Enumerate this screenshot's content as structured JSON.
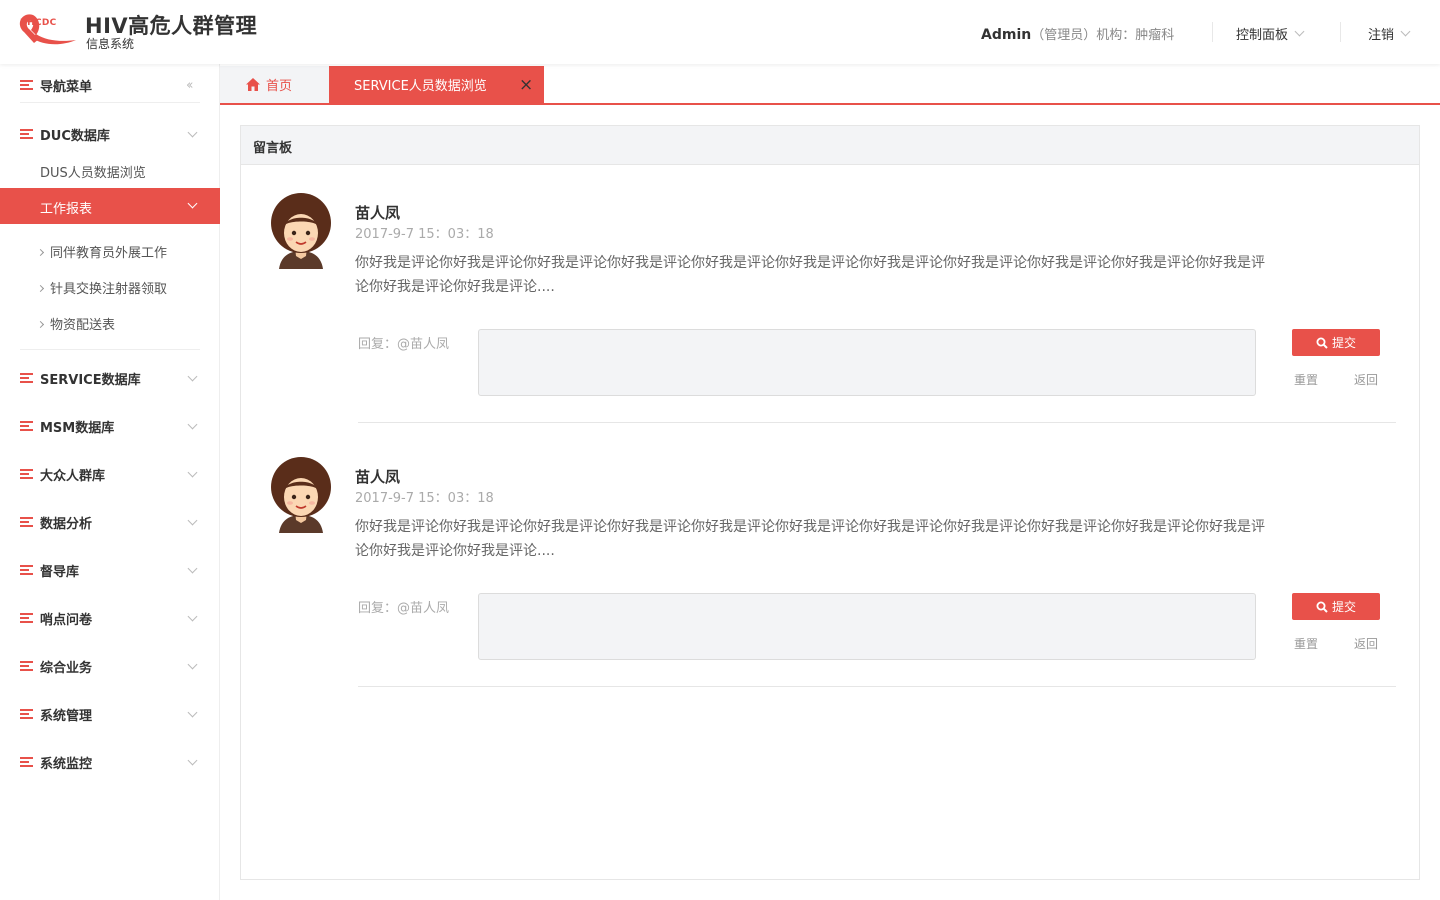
{
  "app": {
    "logo_text": "BHCDC",
    "title": "HIV高危人群管理",
    "subtitle": "信息系统"
  },
  "header": {
    "user_name": "Admin",
    "user_role": "（管理员）",
    "org_label": "机构：",
    "org_name": "肿瘤科",
    "control_panel_label": "控制面板",
    "logout_label": "注销"
  },
  "sidebar": {
    "nav_title": "导航菜单",
    "sections": [
      {
        "label": "DUC数据库"
      },
      {
        "label": "SERVICE数据库"
      },
      {
        "label": "MSM数据库"
      },
      {
        "label": "大众人群库"
      },
      {
        "label": "数据分析"
      },
      {
        "label": "督导库"
      },
      {
        "label": "哨点问卷"
      },
      {
        "label": "综合业务"
      },
      {
        "label": "系统管理"
      },
      {
        "label": "系统监控"
      }
    ],
    "duc_children": {
      "browse": "DUS人员数据浏览",
      "report": "工作报表",
      "report_children": [
        "同伴教育员外展工作",
        "针具交换注射器领取",
        "物资配送表"
      ]
    }
  },
  "tabs": {
    "home": "首页",
    "active": "SERVICE人员数据浏览",
    "close_symbol": "×"
  },
  "panel": {
    "title": "留言板",
    "comments": [
      {
        "author": "苗人凤",
        "time": "2017-9-7 15：03：18",
        "text": "你好我是评论你好我是评论你好我是评论你好我是评论你好我是评论你好我是评论你好我是评论你好我是评论你好我是评论你好我是评论你好我是评论你好我是评论你好我是评论....",
        "reply_label": "回复：@苗人凤",
        "submit_label": "提交",
        "reset_label": "重置",
        "back_label": "返回"
      },
      {
        "author": "苗人凤",
        "time": "2017-9-7 15：03：18",
        "text": "你好我是评论你好我是评论你好我是评论你好我是评论你好我是评论你好我是评论你好我是评论你好我是评论你好我是评论你好我是评论你好我是评论你好我是评论你好我是评论....",
        "reply_label": "回复：@苗人凤",
        "submit_label": "提交",
        "reset_label": "重置",
        "back_label": "返回"
      }
    ]
  },
  "colors": {
    "accent": "#e8514a",
    "panel_bg": "#f3f4f6"
  },
  "icons": [
    "ribbon-logo-icon",
    "menu-list-icon",
    "chevron-down-icon",
    "double-chevron-left-icon",
    "home-icon",
    "close-icon",
    "search-icon",
    "avatar-image"
  ]
}
